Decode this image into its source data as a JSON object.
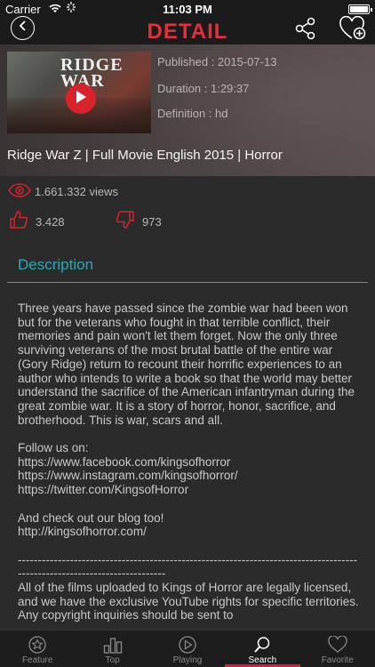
{
  "status": {
    "carrier": "Carrier",
    "time": "11:03 PM",
    "battery_level": 1.0
  },
  "nav": {
    "title": "DETAIL"
  },
  "video": {
    "thumb_title": "RIDGE WAR",
    "published": "Published : 2015-07-13",
    "duration": "Duration : 1:29:37",
    "definition": "Definition : hd",
    "title": "Ridge War Z | Full Movie English 2015 | Horror"
  },
  "stats": {
    "views": "1.661.332 views",
    "likes": "3.428",
    "dislikes": "973"
  },
  "description": {
    "heading": "Description",
    "body": "Three years have passed since the zombie war had been won but for the veterans who fought in that terrible conflict, their memories and pain won't let them forget. Now the only three surviving veterans of the most brutal battle of the entire war (Gory Ridge) return to recount their horrific experiences to an author who intends to write a book so that the world may better understand the sacrifice of the American infantryman during the great zombie war. It is a story of horror, honor, sacrifice, and brotherhood. This is war, scars and all.\n\nFollow us on:\nhttps://www.facebook.com/kingsofhorror\nhttps://www.instagram.com/kingsofhorror/\nhttps://twitter.com/KingsofHorror\n\nAnd check out our blog too!\nhttp://kingsofhorror.com/\n\n--------------------------------------------------------------------------------------------------------------------------\nAll of the films uploaded to Kings of Horror are legally licensed, and we have the exclusive YouTube rights for specific territories. Any copyright inquiries should be sent to"
  },
  "tabs": [
    {
      "label": "Feature",
      "icon": "star-icon",
      "active": false
    },
    {
      "label": "Top",
      "icon": "bar-chart-icon",
      "active": false
    },
    {
      "label": "Playing",
      "icon": "play-circle-icon",
      "active": false
    },
    {
      "label": "Search",
      "icon": "search-icon",
      "active": true
    },
    {
      "label": "Favorite",
      "icon": "heart-icon",
      "active": false
    }
  ],
  "colors": {
    "accent_red": "#d8232c",
    "accent_teal": "#2aa9b6",
    "background": "#2b2b2b",
    "bar": "#1b1b1b"
  }
}
